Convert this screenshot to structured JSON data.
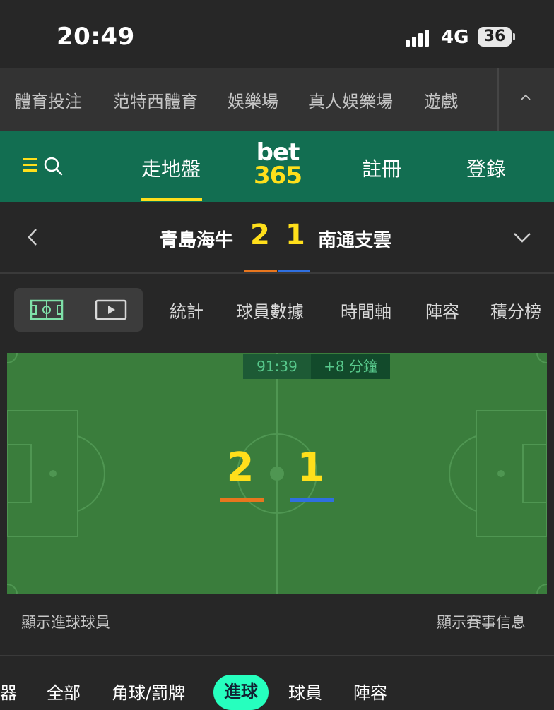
{
  "status_bar": {
    "time": "20:49",
    "network": "4G",
    "battery": "36"
  },
  "category_nav": {
    "items": [
      "體育投注",
      "范特西體育",
      "娛樂場",
      "真人娛樂場",
      "遊戲"
    ]
  },
  "header": {
    "in_play": "走地盤",
    "logo_top": "bet",
    "logo_bottom": "365",
    "register": "註冊",
    "login": "登錄"
  },
  "match": {
    "home_team": "青島海牛",
    "away_team": "南通支雲",
    "home_score": "2",
    "away_score": "1",
    "home_color": "#e8761e",
    "away_color": "#2f6fe0"
  },
  "tabs": [
    "統計",
    "球員數據",
    "時間軸",
    "陣容",
    "積分榜"
  ],
  "pitch": {
    "clock": "91:39",
    "added_time": "+8 分鐘"
  },
  "links": {
    "show_scorers": "顯示進球球員",
    "show_match_info": "顯示賽事信息"
  },
  "filters": {
    "partial": "器",
    "all": "全部",
    "corners_cards": "角球/罰牌",
    "goals": "進球",
    "players": "球員",
    "lineups": "陣容",
    "active": "進球"
  },
  "colors": {
    "accent_yellow": "#ffdf1b",
    "header_green": "#126e51",
    "pitch_green": "#3a7d3c",
    "chip_active": "#26ffbe"
  }
}
